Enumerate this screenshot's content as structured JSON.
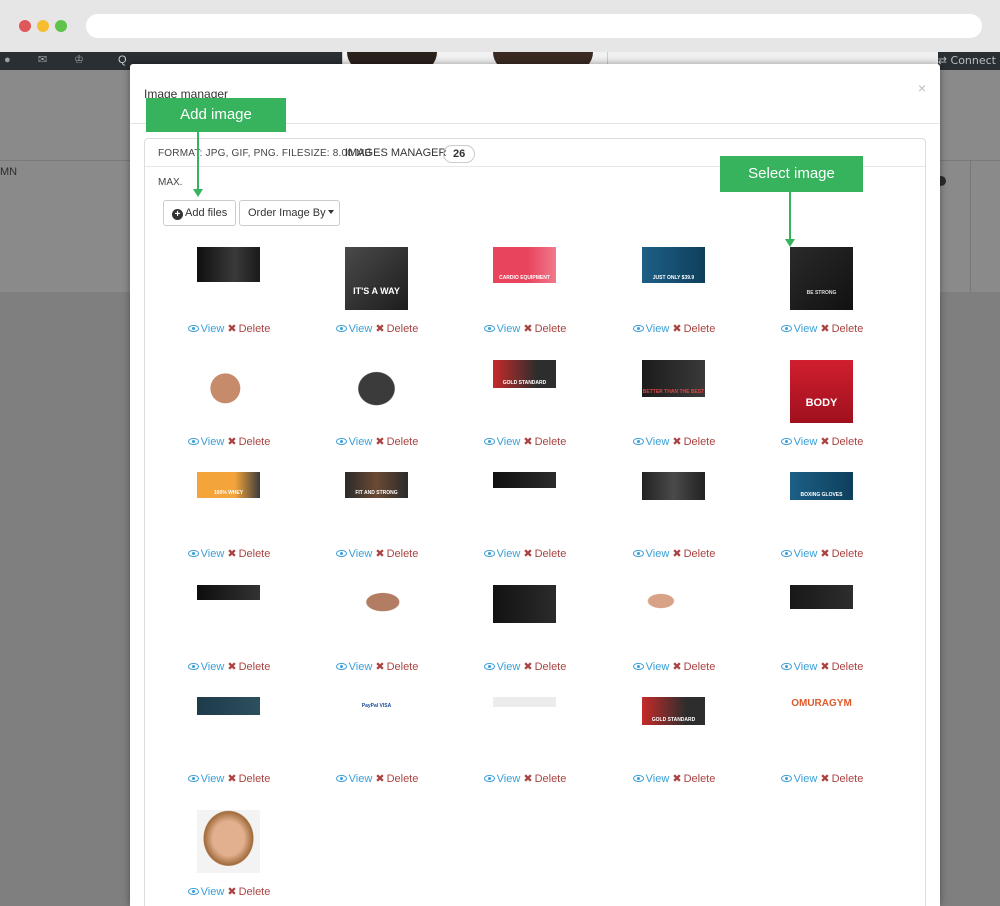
{
  "background": {
    "connect_text": "Connect",
    "side_label": "MN",
    "top_letter": "Q"
  },
  "modal": {
    "title": "Image manager",
    "close": "×",
    "format_text": "FORMAT: JPG, GIF, PNG. FILESIZE: 8.00 MB",
    "max_text": "MAX.",
    "manager_title": "IMAGES MANAGER",
    "count": "26",
    "add_files": "Add files",
    "order_by": "Order Image By"
  },
  "annotations": {
    "add_image": "Add image",
    "select_image": "Select image"
  },
  "actions": {
    "view": "View",
    "delete": "Delete"
  },
  "thumbnail_texts": {
    "t3": "CARDIO EQUIPMENT",
    "t4": "JUST ONLY $39.9",
    "t2": "IT'S A WAY",
    "t5": "BE STRONG",
    "t10": "BODY",
    "t8": "GOLD STANDARD",
    "t9": "BETTER THAN THE BEST",
    "t11": "100% WHEY",
    "t12": "FIT AND STRONG",
    "t15": "BOXING GLOVES",
    "t18": "GOLD STANDARD",
    "t21": "PayPal VISA",
    "t25": "OMURAGYM"
  },
  "colors": {
    "accent_green": "#37b25d",
    "link_blue": "#3a9fd8",
    "delete_red": "#a94442"
  }
}
